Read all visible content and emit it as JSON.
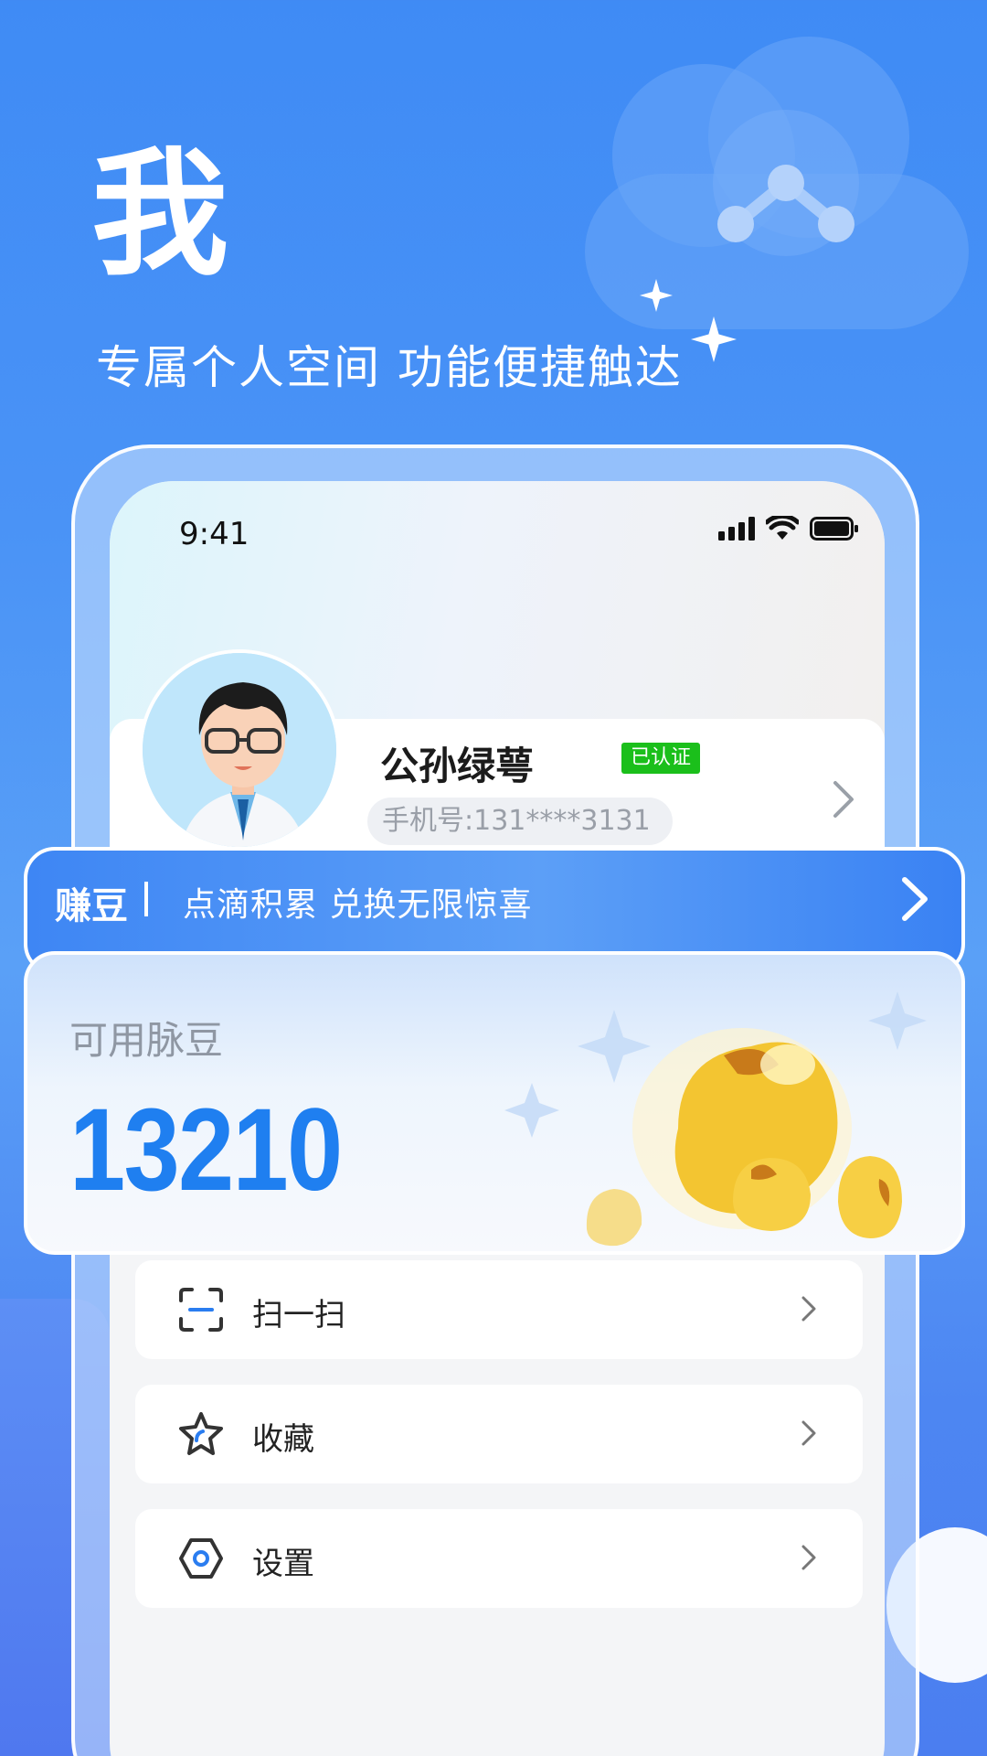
{
  "hero": {
    "title": "我",
    "subtitle": "专属个人空间 功能便捷触达"
  },
  "status_bar": {
    "time": "9:41"
  },
  "profile": {
    "name": "公孙绿萼",
    "verified_label": "已认证",
    "phone": "手机号:131****3131"
  },
  "earn_banner": {
    "title": "赚豆",
    "description": "点滴积累 兑换无限惊喜"
  },
  "beans": {
    "label": "可用脉豆",
    "value": "13210"
  },
  "menu": {
    "items": [
      {
        "label": "扫一扫",
        "icon": "scan-icon"
      },
      {
        "label": "收藏",
        "icon": "star-icon"
      },
      {
        "label": "设置",
        "icon": "settings-icon"
      }
    ]
  },
  "colors": {
    "background": "#4a93f6",
    "accent_blue": "#1f7ff0",
    "verified_green": "#1bbf1b"
  }
}
